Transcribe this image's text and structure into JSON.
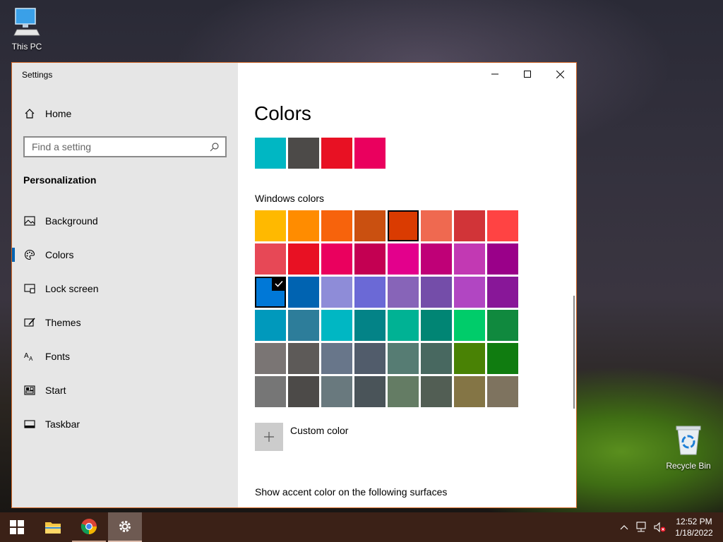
{
  "desktop": {
    "icons": [
      {
        "label": "This PC"
      },
      {
        "label": "Recycle Bin"
      }
    ]
  },
  "window": {
    "title": "Settings",
    "border_color": "#d46a2a",
    "controls": [
      "minimize",
      "maximize",
      "close"
    ]
  },
  "nav": {
    "home_label": "Home",
    "search_placeholder": "Find a setting",
    "section_label": "Personalization",
    "items": [
      {
        "label": "Background",
        "icon": "image-icon"
      },
      {
        "label": "Colors",
        "icon": "palette-icon",
        "active": true
      },
      {
        "label": "Lock screen",
        "icon": "lock-screen-icon"
      },
      {
        "label": "Themes",
        "icon": "themes-icon"
      },
      {
        "label": "Fonts",
        "icon": "fonts-icon"
      },
      {
        "label": "Start",
        "icon": "start-icon"
      },
      {
        "label": "Taskbar",
        "icon": "taskbar-icon"
      }
    ]
  },
  "main": {
    "title": "Colors",
    "recent_colors": [
      "#00b7c3",
      "#4c4a48",
      "#e81123",
      "#ea005e"
    ],
    "windows_colors_label": "Windows colors",
    "windows_colors": [
      "#ffb900",
      "#ff8c00",
      "#f7630c",
      "#ca5010",
      "#da3b01",
      "#ef6950",
      "#d13438",
      "#ff4343",
      "#e74856",
      "#e81123",
      "#ea005e",
      "#c30052",
      "#e3008c",
      "#bf0077",
      "#c239b3",
      "#9a0089",
      "#0078d7",
      "#0063b1",
      "#8e8cd8",
      "#6b69d6",
      "#8764b8",
      "#744da9",
      "#b146c2",
      "#881798",
      "#0099bc",
      "#2d7d9a",
      "#00b7c3",
      "#038387",
      "#00b294",
      "#018574",
      "#00cc6a",
      "#10893e",
      "#7a7574",
      "#5d5a58",
      "#68768a",
      "#515c6b",
      "#567c73",
      "#486860",
      "#498205",
      "#107c10",
      "#767676",
      "#4c4a48",
      "#69797e",
      "#4a5459",
      "#647c64",
      "#525e54",
      "#847545",
      "#7e735f"
    ],
    "outlined_index": 4,
    "selected_index": 16,
    "custom_color_label": "Custom color",
    "show_accent_label": "Show accent color on the following surfaces"
  },
  "taskbar": {
    "background": "#3b2117",
    "apps": [
      "start-button",
      "file-explorer",
      "chrome",
      "settings"
    ],
    "time": "12:52 PM",
    "date": "1/18/2022"
  }
}
